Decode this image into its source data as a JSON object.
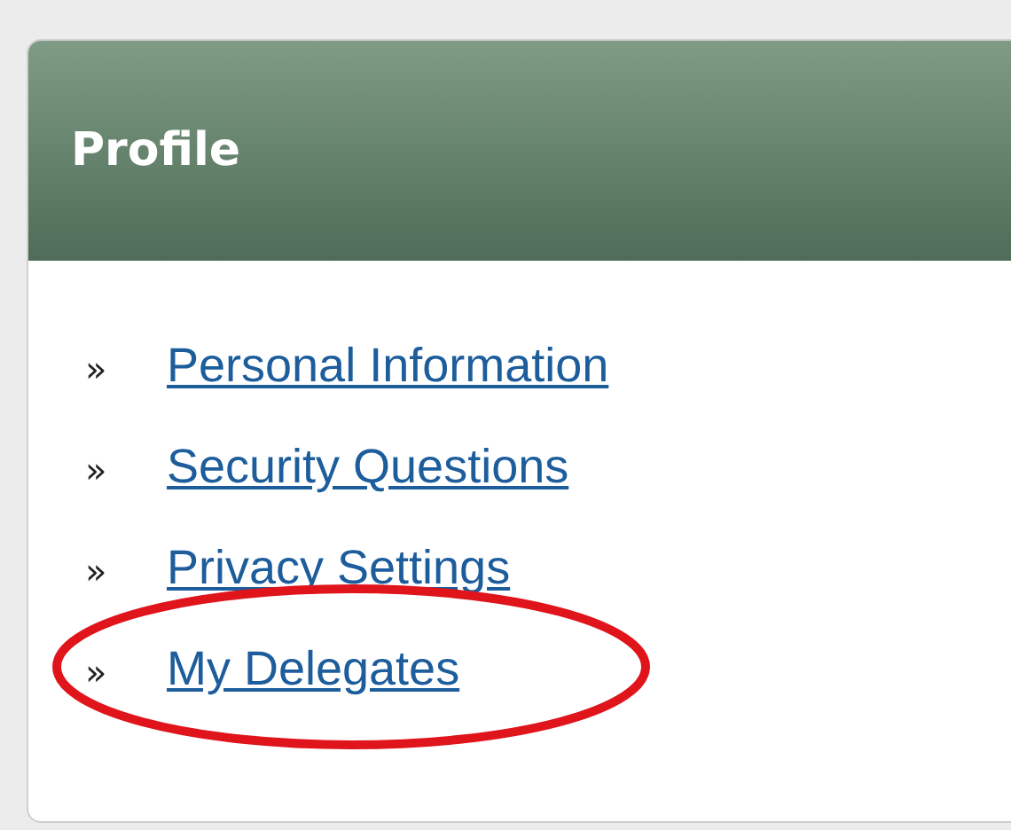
{
  "panel": {
    "title": "Profile"
  },
  "links": [
    {
      "marker": "»",
      "label": "Personal Information"
    },
    {
      "marker": "»",
      "label": "Security Questions"
    },
    {
      "marker": "»",
      "label": "Privacy Settings"
    },
    {
      "marker": "»",
      "label": "My Delegates"
    }
  ]
}
